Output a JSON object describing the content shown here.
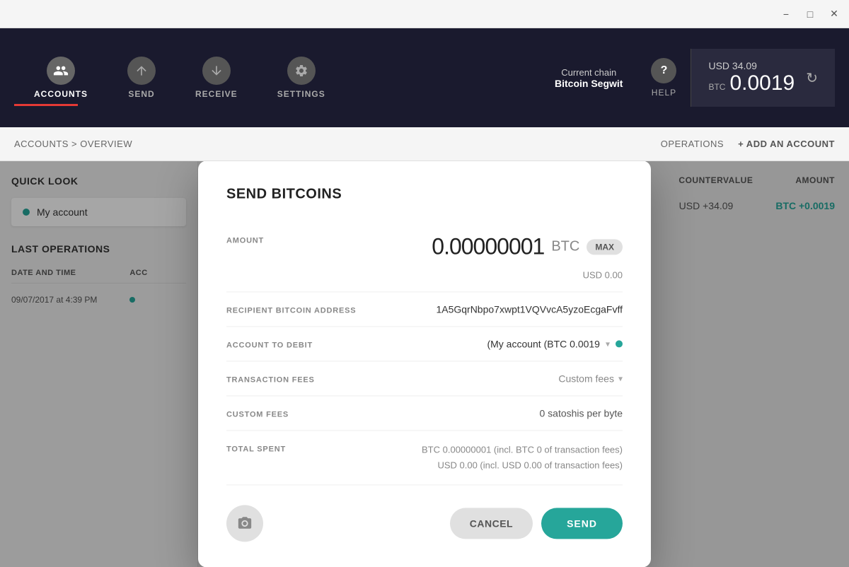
{
  "window": {
    "minimize": "−",
    "maximize": "□",
    "close": "✕"
  },
  "nav": {
    "accounts_label": "ACCOUNTS",
    "send_label": "SEND",
    "receive_label": "RECEIVE",
    "settings_label": "SETTINGS",
    "help_label": "HELP",
    "chain_label": "Current chain",
    "chain_name": "Bitcoin Segwit",
    "balance_usd": "USD 34.09",
    "balance_btc_label": "BTC",
    "balance_btc_value": "0.0019"
  },
  "breadcrumb": {
    "path": "ACCOUNTS > OVERVIEW",
    "operations_btn": "OPERATIONS",
    "add_account_btn": "+ ADD AN ACCOUNT"
  },
  "sidebar": {
    "quick_look_title": "QUICK LOOK",
    "account_name": "My account",
    "last_ops_title": "LAST OPERATIONS",
    "col_date": "DATE AND TIME",
    "col_acc": "ACC",
    "op_date": "09/07/2017 at 4:39 PM"
  },
  "right_panel": {
    "col_countervalue": "COUNTERVALUE",
    "col_amount": "AMOUNT",
    "countervalue": "USD +34.09",
    "amount": "BTC +0.0019"
  },
  "modal": {
    "title": "SEND BITCOINS",
    "amount_label": "AMOUNT",
    "amount_value": "0.00000001",
    "amount_currency": "BTC",
    "max_label": "MAX",
    "amount_usd": "USD 0.00",
    "recipient_label": "RECIPIENT BITCOIN ADDRESS",
    "recipient_value": "1A5GqrNbpo7xwpt1VQVvcA5yzoEcgaFvff",
    "account_debit_label": "ACCOUNT TO DEBIT",
    "account_debit_value": "(My account (BTC 0.0019",
    "transaction_fees_label": "TRANSACTION FEES",
    "fees_value": "Custom fees",
    "custom_fees_label": "CUSTOM FEES",
    "custom_fees_value": "0 satoshis per byte",
    "total_spent_label": "TOTAL SPENT",
    "total_spent_line1": "BTC 0.00000001 (incl. BTC 0 of transaction fees)",
    "total_spent_line2": "USD 0.00 (incl. USD 0.00 of transaction fees)",
    "cancel_btn": "CANCEL",
    "send_btn": "SEND"
  }
}
